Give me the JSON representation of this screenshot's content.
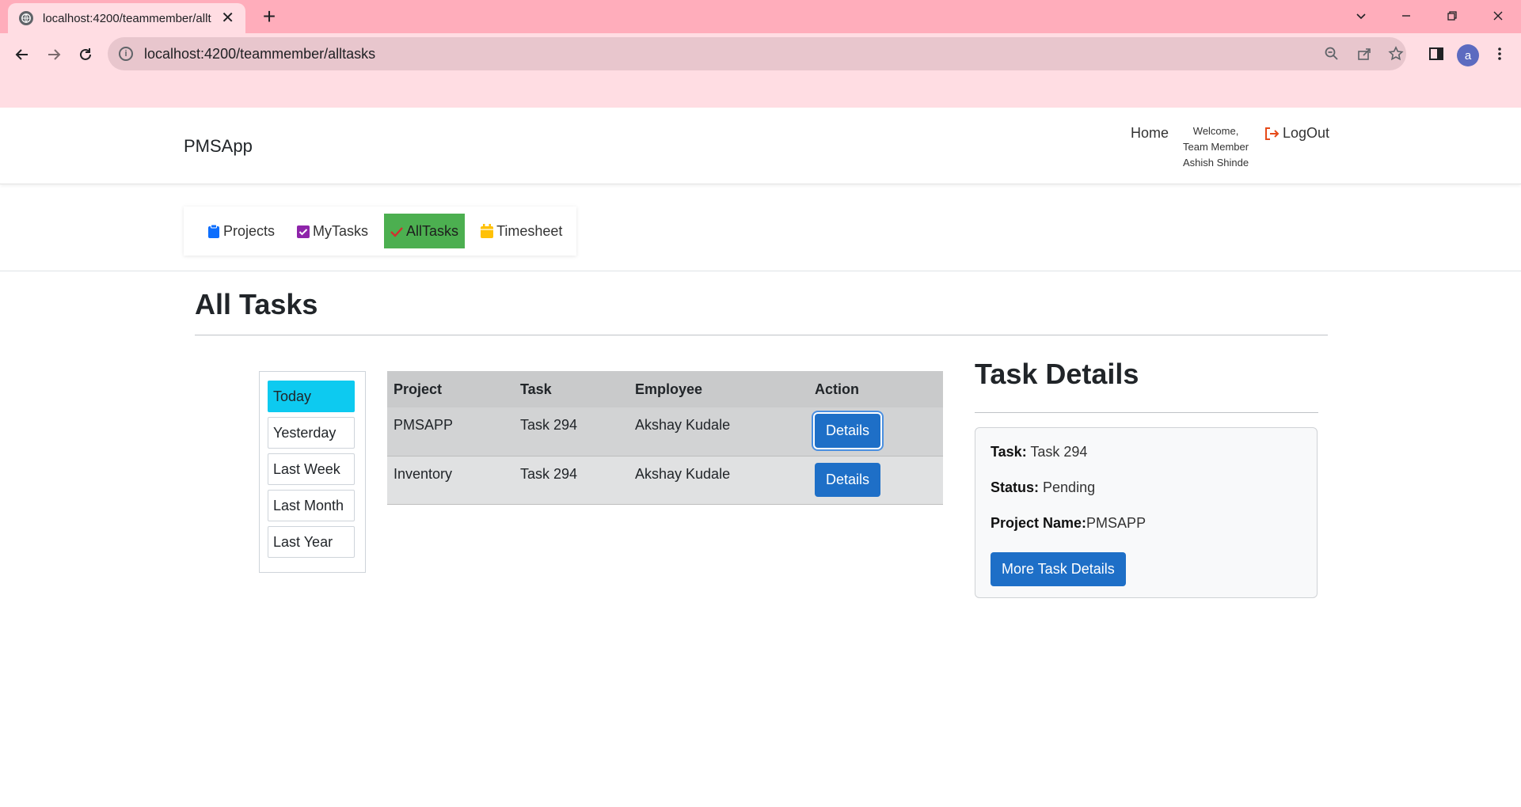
{
  "browser": {
    "tab_title": "localhost:4200/teammember/allt",
    "url": "localhost:4200/teammember/alltasks",
    "profile_initial": "a",
    "chrome_color": "#ffadbb",
    "toolbar_color": "#ffdde3"
  },
  "header": {
    "brand": "PMSApp",
    "home_label": "Home",
    "welcome_line1": "Welcome,",
    "welcome_line2": "Team Member",
    "welcome_line3": "Ashish Shinde",
    "logout_label": "LogOut"
  },
  "subnav": {
    "items": [
      {
        "label": "Projects",
        "icon": "clipboard-icon",
        "active": false
      },
      {
        "label": "MyTasks",
        "icon": "checkbox-icon",
        "active": false
      },
      {
        "label": "AllTasks",
        "icon": "check-icon",
        "active": true
      },
      {
        "label": "Timesheet",
        "icon": "calendar-icon",
        "active": false
      }
    ],
    "active_color": "#4caf50"
  },
  "page": {
    "title": "All Tasks"
  },
  "filters": {
    "items": [
      "Today",
      "Yesterday",
      "Last Week",
      "Last Month",
      "Last Year"
    ],
    "active_index": 0,
    "active_color": "#0dcaf0"
  },
  "table": {
    "headers": [
      "Project",
      "Task",
      "Employee",
      "Action"
    ],
    "rows": [
      {
        "project": "PMSAPP",
        "task": "Task 294",
        "employee": "Akshay Kudale",
        "action": "Details"
      },
      {
        "project": "Inventory",
        "task": "Task 294",
        "employee": "Akshay Kudale",
        "action": "Details"
      }
    ]
  },
  "details": {
    "title": "Task Details",
    "task_label": "Task:",
    "task_value": "Task 294",
    "status_label": "Status:",
    "status_value": "Pending",
    "project_label": "Project Name:",
    "project_value": "PMSAPP",
    "more_button": "More Task Details",
    "button_color": "#1e6fc7"
  }
}
